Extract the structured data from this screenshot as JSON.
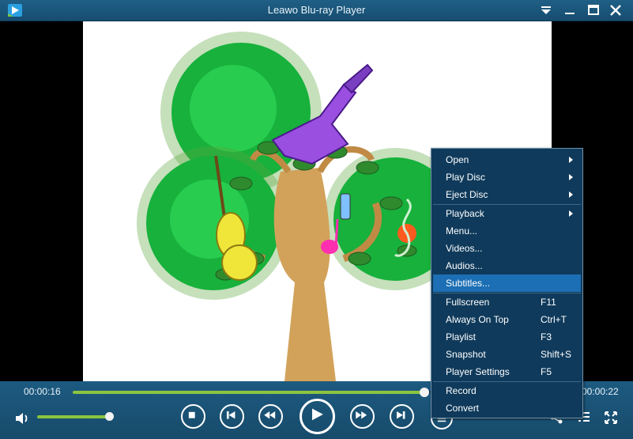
{
  "window": {
    "title": "Leawo Blu-ray Player"
  },
  "playback": {
    "elapsed": "00:00:16",
    "total": "00:00:22",
    "progress": 0.695,
    "volume": 0.98
  },
  "context_menu": {
    "groups": [
      [
        {
          "label": "Open",
          "submenu": true
        },
        {
          "label": "Play Disc",
          "submenu": true
        },
        {
          "label": "Eject Disc",
          "submenu": true
        }
      ],
      [
        {
          "label": "Playback",
          "submenu": true
        },
        {
          "label": "Menu...",
          "submenu": false
        },
        {
          "label": "Videos...",
          "submenu": false
        },
        {
          "label": "Audios...",
          "submenu": false
        },
        {
          "label": "Subtitles...",
          "submenu": false,
          "highlighted": true
        }
      ],
      [
        {
          "label": "Fullscreen",
          "shortcut": "F11"
        },
        {
          "label": "Always On Top",
          "shortcut": "Ctrl+T"
        },
        {
          "label": "Playlist",
          "shortcut": "F3"
        },
        {
          "label": "Snapshot",
          "shortcut": "Shift+S"
        },
        {
          "label": "Player Settings",
          "shortcut": "F5"
        }
      ],
      [
        {
          "label": "Record"
        },
        {
          "label": "Convert"
        }
      ]
    ]
  },
  "icons": {
    "app": "leawo-play-icon",
    "dropdown": "dropdown-arrow-icon",
    "maximize": "maximize-icon",
    "close": "close-icon",
    "volume": "speaker-icon",
    "stop": "stop-icon",
    "previous": "skip-previous-icon",
    "rewind": "rewind-icon",
    "play": "play-icon",
    "forward": "fast-forward-icon",
    "next": "skip-next-icon",
    "menu": "menu-circle-icon",
    "share": "share-icon",
    "playlist": "playlist-icon",
    "fullscreen": "fullscreen-icon"
  },
  "colors": {
    "chrome": "#1b5478",
    "accent_green": "#8bc53f",
    "menu_bg": "#0f3a5b",
    "menu_highlight": "#1c6fb4"
  }
}
